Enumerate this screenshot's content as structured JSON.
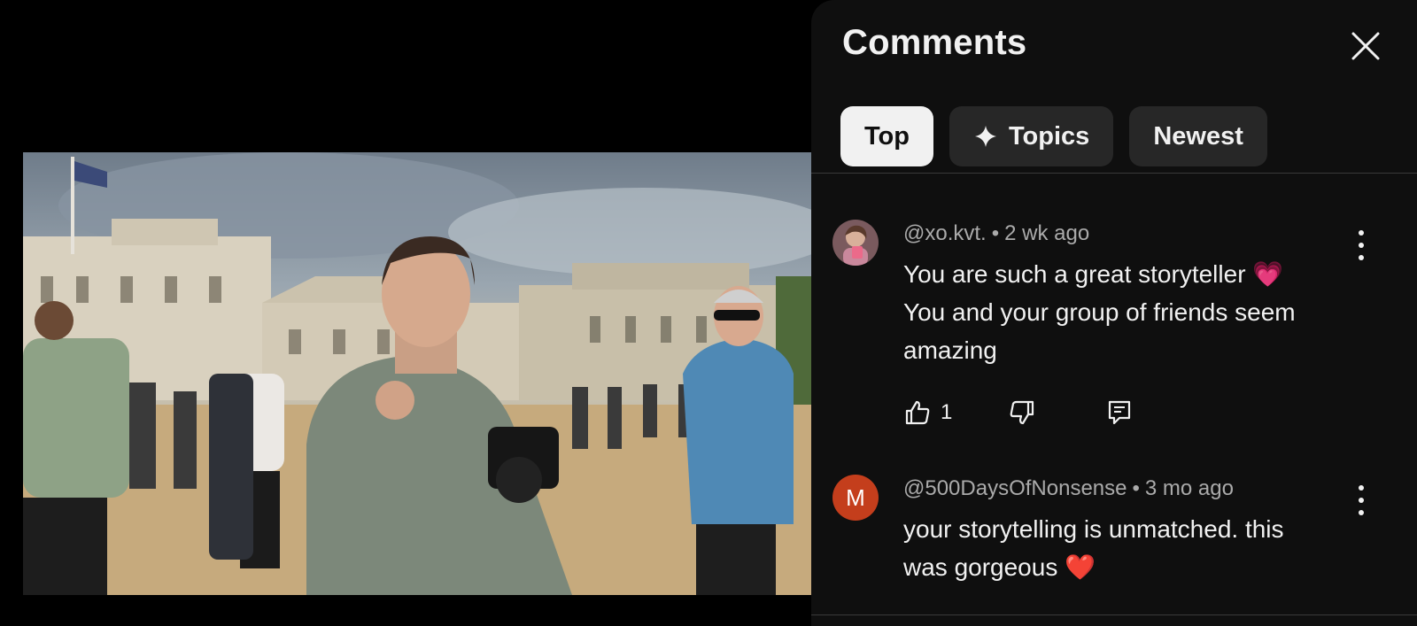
{
  "panel": {
    "title": "Comments",
    "chips": [
      {
        "label": "Top",
        "active": true
      },
      {
        "label": "Topics",
        "icon": "sparkle-icon"
      },
      {
        "label": "Newest"
      }
    ]
  },
  "comments": [
    {
      "author": "@xo.kvt.",
      "age": "2 wk ago",
      "text_lines": [
        "You are such a great storyteller 💗",
        "You and your group of friends seem",
        "amazing"
      ],
      "likes": "1"
    },
    {
      "author": "@500DaysOfNonsense",
      "age": "3 mo ago",
      "avatar_letter": "M",
      "text_lines": [
        "your storytelling is unmatched. this",
        "was gorgeous ❤️"
      ]
    }
  ],
  "colors": {
    "panel_bg": "#0f0f0f",
    "chip_bg": "#272727",
    "chip_active_bg": "#f1f1f1",
    "avatar_m": "#c43e1c"
  }
}
